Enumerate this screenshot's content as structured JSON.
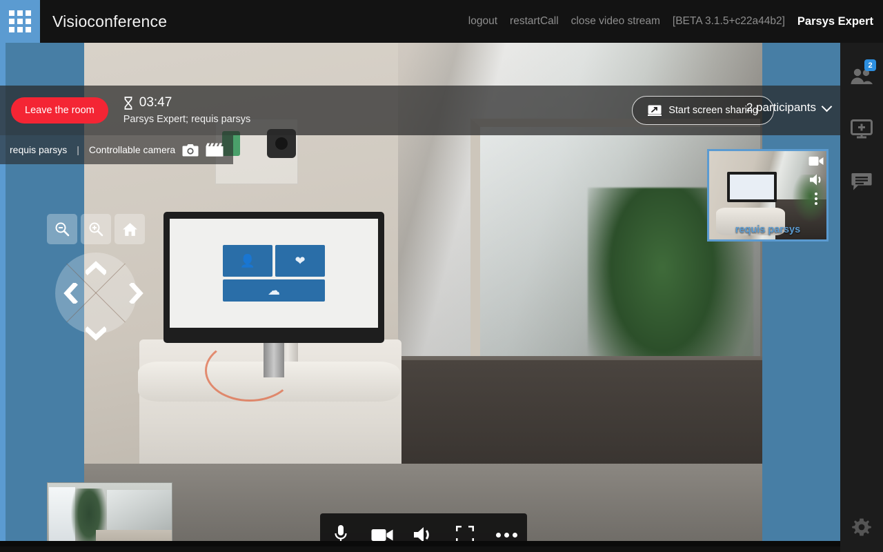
{
  "header": {
    "apps_icon": "grid-apps-icon",
    "title": "Visioconference",
    "links": [
      {
        "label": "logout",
        "name": "logout-link"
      },
      {
        "label": "restartCall",
        "name": "restart-call-link"
      },
      {
        "label": "close video stream",
        "name": "close-video-stream-link"
      }
    ],
    "version": "[BETA 3.1.5+c22a44b2]",
    "user": "Parsys Expert"
  },
  "toolbar": {
    "leave_label": "Leave the room",
    "timer_icon": "hourglass-icon",
    "timer": "03:47",
    "participant_names": "Parsys Expert; requis parsys",
    "share_icon": "screen-share-icon",
    "share_label": "Start screen sharing",
    "participants_label": "2 participants",
    "participants_chevron": "chevron-down-icon"
  },
  "sourcebar": {
    "source_name": "requis parsys",
    "separator": "|",
    "camera_mode": "Controllable camera",
    "snapshot_icon": "photo-camera-icon",
    "record_icon": "clapperboard-icon"
  },
  "ptz": {
    "zoom_out_icon": "zoom-out-icon",
    "zoom_in_icon": "zoom-in-icon",
    "home_icon": "home-icon",
    "pad_up": "arrow-up-icon",
    "pad_down": "arrow-down-icon",
    "pad_left": "arrow-left-icon",
    "pad_right": "arrow-right-icon"
  },
  "pip": {
    "label": "requis parsys",
    "video_icon": "video-camera-icon",
    "audio_icon": "speaker-icon",
    "more_icon": "more-vertical-icon",
    "border_color": "#5b9bd1"
  },
  "mediabar": {
    "buttons": [
      {
        "name": "microphone-button",
        "icon": "microphone-icon"
      },
      {
        "name": "camera-button",
        "icon": "video-camera-icon"
      },
      {
        "name": "speaker-button",
        "icon": "speaker-icon"
      },
      {
        "name": "fullscreen-button",
        "icon": "fullscreen-icon"
      },
      {
        "name": "more-options-button",
        "icon": "more-horizontal-icon"
      }
    ]
  },
  "sidebar": {
    "participants_icon": "people-icon",
    "participants_badge": "2",
    "add_screen_icon": "add-screen-icon",
    "chat_icon": "chat-bubble-icon",
    "settings_icon": "gear-icon"
  },
  "selfview": {
    "name": "self-view-thumbnail"
  },
  "monitor_tiles": {
    "tile1_icon": "person-icon",
    "tile2_icon": "heart-pulse-icon",
    "tile3_icon": "cloud-icon"
  },
  "colors": {
    "accent_blue": "#5b9bd1",
    "band_blue": "#477ea5",
    "leave_red": "#f42534",
    "header_bg": "#131313",
    "sidebar_bg": "#1c1c1c",
    "badge_blue": "#2d8fe0"
  }
}
